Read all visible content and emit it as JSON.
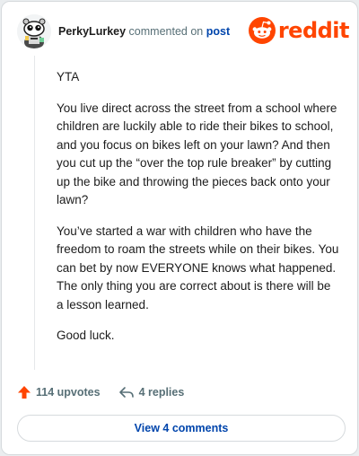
{
  "header": {
    "username": "PerkyLurkey",
    "commented_on": "commented on",
    "post_link": "post",
    "brand": "reddit"
  },
  "comment": {
    "paragraphs": [
      "YTA",
      "You live direct across the street from a school where children are luckily able to ride their bikes to school, and you focus on bikes left on your lawn? And then you cut up the “over the top rule breaker” by cutting up the bike and throwing the pieces back onto your lawn?",
      "You’ve started a war with children who have the freedom to roam the streets while on their bikes. You can bet by now EVERYONE knows what happened. The only thing you are correct about is there will be a lesson learned.",
      "Good luck."
    ]
  },
  "actions": {
    "upvotes": "114 upvotes",
    "replies": "4 replies",
    "upvote_icon": "upvote-arrow-icon",
    "reply_icon": "reply-arrow-icon"
  },
  "footer": {
    "view_comments": "View 4 comments"
  },
  "colors": {
    "brand": "#ff4500",
    "link": "#0045ac",
    "muted": "#576f76"
  }
}
